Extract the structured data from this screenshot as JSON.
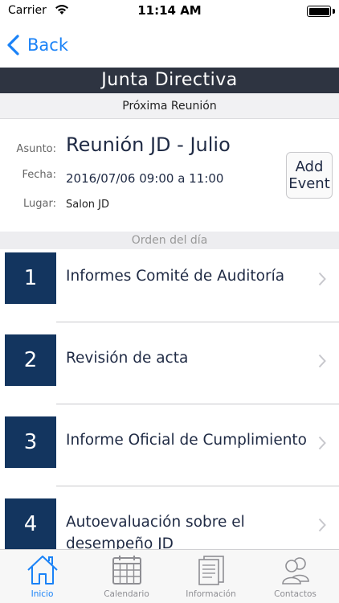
{
  "status_bar": {
    "carrier": "Carrier",
    "time": "11:14 AM"
  },
  "nav": {
    "back_label": "Back"
  },
  "header": {
    "title": "Junta Directiva",
    "subtitle": "Próxima Reunión"
  },
  "meeting": {
    "asunto_label": "Asunto:",
    "asunto": "Reunión JD - Julio",
    "fecha_label": "Fecha:",
    "fecha": "2016/07/06 09:00 a 11:00",
    "lugar_label": "Lugar:",
    "lugar": "Salon JD",
    "add_event_line1": "Add",
    "add_event_line2": "Event"
  },
  "agenda": {
    "header": "Orden del día",
    "items": [
      {
        "number": "1",
        "title": "Informes Comité de Auditoría"
      },
      {
        "number": "2",
        "title": "Revisión de acta"
      },
      {
        "number": "3",
        "title": "Informe Oficial de Cumplimiento"
      },
      {
        "number": "4",
        "title": "Autoevaluación sobre el desempeño JD"
      }
    ]
  },
  "tabs": [
    {
      "label": "Inicio",
      "icon": "home-icon",
      "active": true
    },
    {
      "label": "Calendario",
      "icon": "calendar-icon",
      "active": false
    },
    {
      "label": "Información",
      "icon": "document-icon",
      "active": false
    },
    {
      "label": "Contactos",
      "icon": "contacts-icon",
      "active": false
    }
  ],
  "colors": {
    "accent": "#1a82f7",
    "header_band": "#2e3441",
    "number_tile": "#13355f",
    "text_dark": "#1f2a44"
  }
}
